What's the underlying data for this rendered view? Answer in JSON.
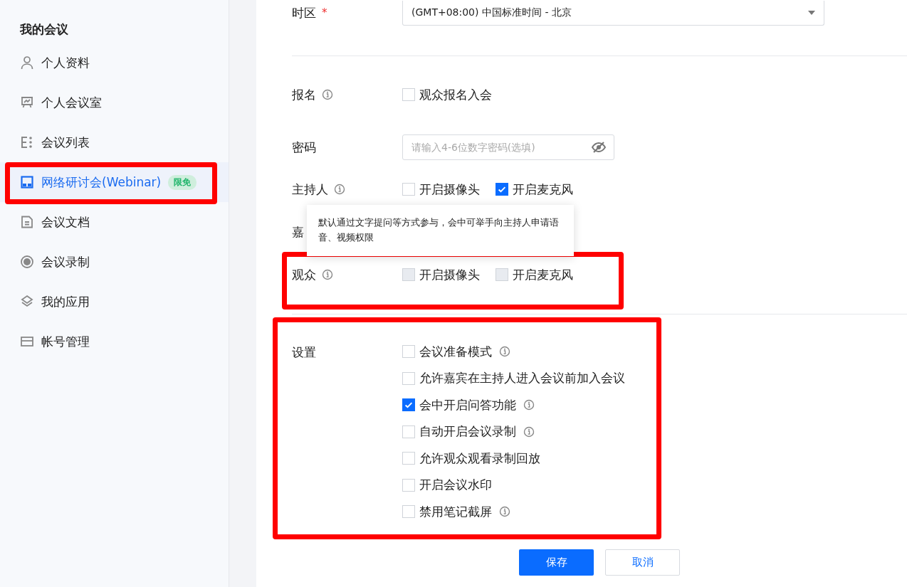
{
  "sidebar": {
    "title": "我的会议",
    "items": [
      {
        "label": "个人资料",
        "selected": false,
        "highlighted": false
      },
      {
        "label": "个人会议室",
        "selected": false,
        "highlighted": false
      },
      {
        "label": "会议列表",
        "selected": false,
        "highlighted": false
      },
      {
        "label": "网络研讨会(Webinar)",
        "selected": true,
        "badge": "限免",
        "highlighted": true
      },
      {
        "label": "会议文档",
        "selected": false,
        "highlighted": false
      },
      {
        "label": "会议录制",
        "selected": false,
        "highlighted": false
      },
      {
        "label": "我的应用",
        "selected": false,
        "highlighted": false
      },
      {
        "label": "帐号管理",
        "selected": false,
        "highlighted": false
      }
    ]
  },
  "form": {
    "timezone": {
      "label": "时区",
      "required": "*",
      "value": "(GMT+08:00) 中国标准时间 - 北京"
    },
    "registration": {
      "label": "报名",
      "info": true,
      "option": {
        "label": "观众报名入会",
        "checked": false
      }
    },
    "password": {
      "label": "密码",
      "placeholder": "请输入4-6位数字密码(选填)"
    },
    "roles": [
      {
        "label": "主持人",
        "info": true,
        "highlighted": false,
        "options": [
          {
            "label": "开启摄像头",
            "checked": false,
            "disabled": false
          },
          {
            "label": "开启麦克风",
            "checked": true,
            "disabled": false
          }
        ]
      },
      {
        "label": "嘉",
        "info": false,
        "highlighted": false
      },
      {
        "label": "观众",
        "info": true,
        "highlighted": true,
        "options": [
          {
            "label": "开启摄像头",
            "checked": false,
            "disabled": true
          },
          {
            "label": "开启麦克风",
            "checked": false,
            "disabled": true
          }
        ]
      }
    ],
    "tooltip": "默认通过文字提问等方式参与，会中可举手向主持人申请语音、视频权限",
    "settings": {
      "label": "设置",
      "highlighted": true,
      "items": [
        {
          "label": "会议准备模式",
          "checked": false,
          "info": true
        },
        {
          "label": "允许嘉宾在主持人进入会议前加入会议",
          "checked": false,
          "info": false
        },
        {
          "label": "会中开启问答功能",
          "checked": true,
          "info": true
        },
        {
          "label": "自动开启会议录制",
          "checked": false,
          "info": true
        },
        {
          "label": "允许观众观看录制回放",
          "checked": false,
          "info": false
        },
        {
          "label": "开启会议水印",
          "checked": false,
          "info": false
        },
        {
          "label": "禁用笔记截屏",
          "checked": false,
          "info": true
        }
      ]
    },
    "buttons": [
      {
        "label": "保存",
        "kind": "primary"
      },
      {
        "label": "取消",
        "kind": "secondary"
      }
    ]
  }
}
